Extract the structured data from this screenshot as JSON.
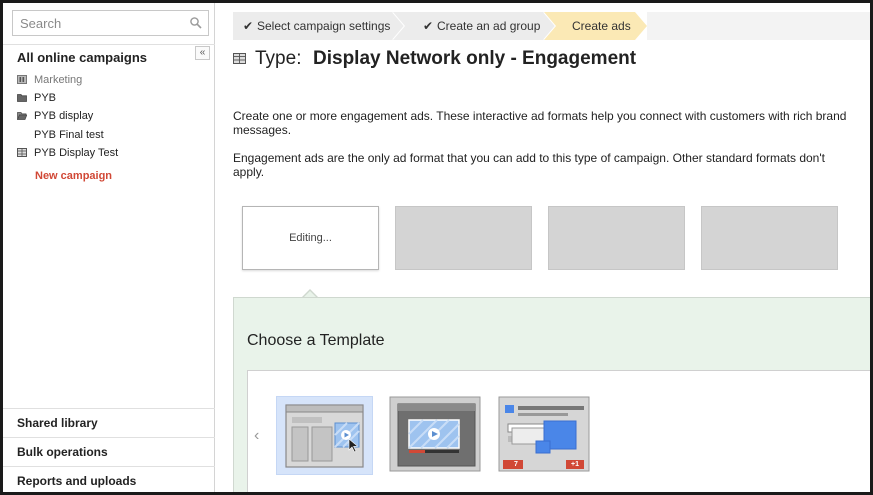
{
  "sidebar": {
    "search_placeholder": "Search",
    "all_campaigns_label": "All online campaigns",
    "collapse_glyph": "«",
    "campaigns": [
      {
        "label": "Marketing",
        "icon": "paused-campaign-icon",
        "muted": true
      },
      {
        "label": "PYB",
        "icon": "folder-icon",
        "muted": false
      },
      {
        "label": "PYB display",
        "icon": "open-folder-icon",
        "muted": false
      },
      {
        "label": "PYB Final test",
        "icon": "",
        "muted": false
      },
      {
        "label": "PYB Display Test",
        "icon": "grid-icon",
        "muted": false
      }
    ],
    "new_campaign_label": "New campaign",
    "bottom_items": [
      "Shared library",
      "Bulk operations",
      "Reports and uploads"
    ]
  },
  "breadcrumbs": [
    {
      "label": "Select campaign settings",
      "done": true
    },
    {
      "label": "Create an ad group",
      "done": true
    },
    {
      "label": "Create ads",
      "active": true
    }
  ],
  "type_row": {
    "label": "Type:",
    "value": "Display Network only - Engagement"
  },
  "paragraphs": {
    "p1": "Create one or more engagement ads. These interactive ad formats help you connect with customers with rich brand messages.",
    "p2": "Engagement ads are the only ad format that you can add to this type of campaign. Other standard formats don't apply."
  },
  "thumbnails": {
    "editing_label": "Editing..."
  },
  "template_panel": {
    "title": "Choose a Template",
    "prev_glyph": "‹",
    "templates": [
      {
        "name": "template-video-overlay",
        "selected": true
      },
      {
        "name": "template-video-dark",
        "selected": false
      },
      {
        "name": "template-social",
        "selected": false,
        "badge_left": "7",
        "badge_right": "+1"
      }
    ]
  },
  "colors": {
    "active_crumb": "#fbe9b5",
    "new_campaign": "#d14836",
    "panel_bg": "#e9f3ea"
  }
}
